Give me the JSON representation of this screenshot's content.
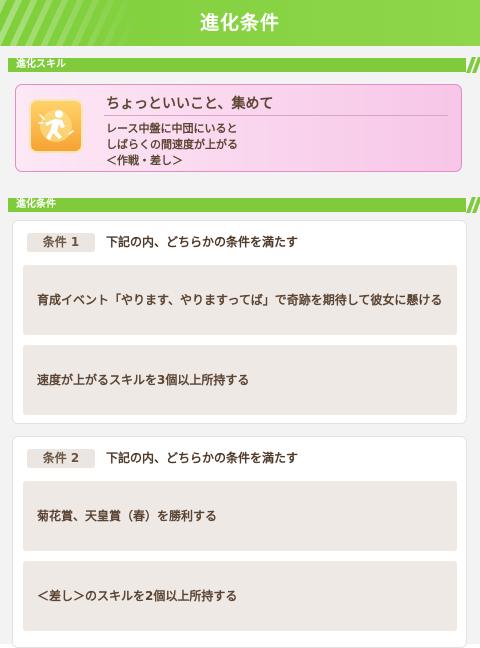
{
  "header": {
    "title": "進化条件"
  },
  "sections": {
    "skill_label": "進化スキル",
    "conditions_label": "進化条件"
  },
  "skill": {
    "name": "ちょっといいこと、集めて",
    "desc_line1": "レース中盤に中団にいると",
    "desc_line2": "しばらくの間速度が上がる",
    "desc_line3": "＜作戦・差し＞",
    "icon": "running-figure-icon"
  },
  "conditions": [
    {
      "tag": "条件 1",
      "title": "下記の内、どちらかの条件を満たす",
      "items": [
        "育成イベント「やります、やりますってば」で奇跡を期待して彼女に懸ける",
        "速度が上がるスキルを3個以上所持する"
      ]
    },
    {
      "tag": "条件 2",
      "title": "下記の内、どちらかの条件を満たす",
      "items": [
        "菊花賞、天皇賞（春）を勝利する",
        "＜差し＞のスキルを2個以上所持する"
      ]
    }
  ],
  "colors": {
    "header_green": "#7fcf3c",
    "skill_pink": "#f7c6e8",
    "text_brown": "#5b4633"
  }
}
